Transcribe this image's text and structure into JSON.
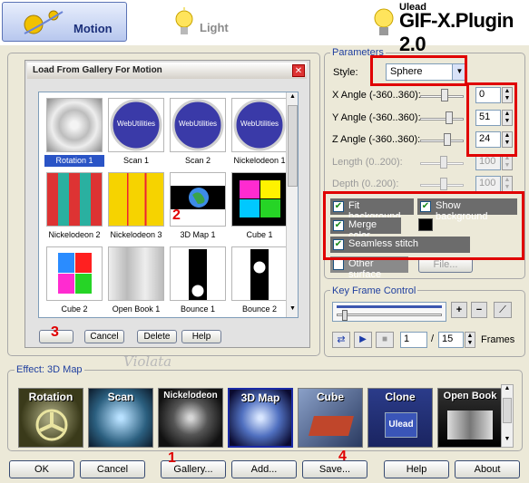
{
  "header": {
    "tab_motion": "Motion",
    "tab_light": "Light",
    "brand_small": "Ulead",
    "brand": "GIF-X.Plugin 2.0"
  },
  "gallery": {
    "title": "Load From Gallery For Motion",
    "close": "✕",
    "items": [
      {
        "label": "Rotation 1",
        "selected": true
      },
      {
        "label": "Scan 1"
      },
      {
        "label": "Scan 2"
      },
      {
        "label": "Nickelodeon 1"
      },
      {
        "label": "Nickelodeon 2"
      },
      {
        "label": "Nickelodeon 3"
      },
      {
        "label": "3D Map 1"
      },
      {
        "label": "Cube 1"
      },
      {
        "label": "Cube 2"
      },
      {
        "label": "Open Book 1"
      },
      {
        "label": "Bounce 1"
      },
      {
        "label": "Bounce 2"
      }
    ],
    "webutilities_text": "WebUtilities",
    "buttons": {
      "ok": "",
      "cancel": "Cancel",
      "delete": "Delete",
      "help": "Help"
    }
  },
  "watermark": "Violata",
  "parameters": {
    "title": "Parameters",
    "style_label": "Style:",
    "style_value": "Sphere",
    "x_label": "X Angle (-360..360):",
    "x_value": "0",
    "y_label": "Y Angle (-360..360):",
    "y_value": "51",
    "z_label": "Z Angle (-360..360):",
    "z_value": "24",
    "length_label": "Length (0..200):",
    "length_value": "100",
    "depth_label": "Depth (0..200):",
    "depth_value": "100",
    "fit_background": "Fit background",
    "show_background": "Show background",
    "merge_color": "Merge color",
    "seamless_stitch": "Seamless stitch",
    "other_surface": "Other surface",
    "file_button": "File..."
  },
  "keyframe": {
    "title": "Key Frame Control",
    "current": "1",
    "separator": "/",
    "total": "15",
    "frames_label": "Frames"
  },
  "effects": {
    "title": "Effect: 3D Map",
    "items": [
      {
        "label": "Rotation"
      },
      {
        "label": "Scan"
      },
      {
        "label": "Nickelodeon"
      },
      {
        "label": "3D Map",
        "selected": true
      },
      {
        "label": "Cube"
      },
      {
        "label": "Clone"
      },
      {
        "label": "Open Book"
      }
    ],
    "clone_sub": "Ulead"
  },
  "bottom": {
    "ok": "OK",
    "cancel": "Cancel",
    "gallery": "Gallery...",
    "add": "Add...",
    "save": "Save...",
    "help": "Help",
    "about": "About"
  },
  "annotations": [
    "1",
    "2",
    "3",
    "4"
  ],
  "colors": {
    "accent_red": "#e00000",
    "selection_blue": "#2a54c6",
    "group_title": "#1f3f9f"
  }
}
